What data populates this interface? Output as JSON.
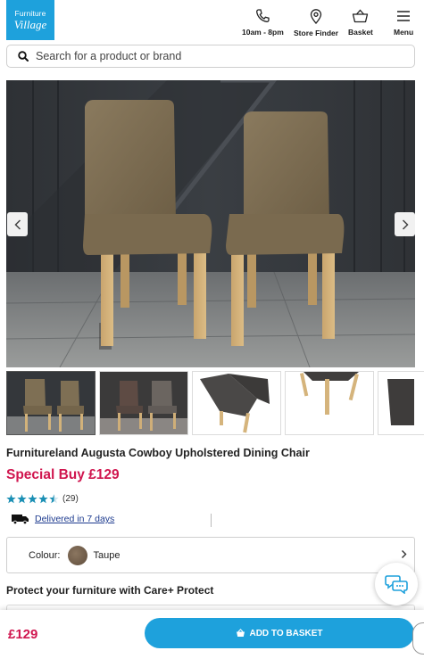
{
  "header": {
    "logo_line1": "Furniture",
    "logo_line2": "Village",
    "hours_label": "10am - 8pm",
    "store_finder_label": "Store Finder",
    "basket_label": "Basket",
    "menu_label": "Menu"
  },
  "search": {
    "placeholder": "Search for a product or brand"
  },
  "product": {
    "title": "Furnitureland Augusta Cowboy Upholstered Dining Chair",
    "special_price": "Special Buy £129",
    "rating": 4.5,
    "review_count": "(29)",
    "delivery_text": "Delivered in 7 days",
    "colour_label": "Colour:",
    "colour_value": "Taupe",
    "protect_heading": "Protect your furniture with Care+ Protect"
  },
  "gallery": {
    "image_count": 5,
    "selected_index": 0
  },
  "sticky_bar": {
    "price": "£129",
    "add_button_label": "ADD TO BASKET"
  },
  "colors": {
    "brand_blue": "#1ea1dc",
    "price_red": "#d0164f",
    "link_blue": "#1d3b8f",
    "star_teal": "#1a8fb4"
  }
}
